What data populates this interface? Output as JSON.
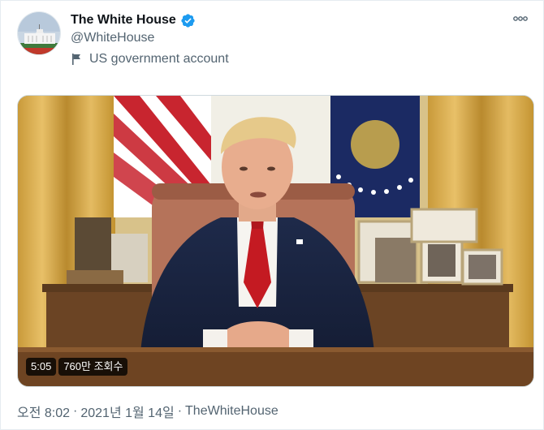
{
  "author": {
    "display_name": "The White House",
    "handle": "@WhiteHouse",
    "label": "US government account",
    "verified": true
  },
  "icons": {
    "avatar": "white-house-avatar",
    "verified": "verified-badge-icon",
    "flag": "flag-icon",
    "more": "more-options-icon"
  },
  "media": {
    "duration": "5:05",
    "views": "760만 조회수"
  },
  "footer": {
    "time": "오전 8:02",
    "separator": "·",
    "date": "2021년 1월 14일",
    "separator2": "·",
    "source": "TheWhiteHouse"
  },
  "colors": {
    "verified_blue": "#1d9bf0",
    "secondary_text": "#536471",
    "primary_text": "#0f1419"
  }
}
